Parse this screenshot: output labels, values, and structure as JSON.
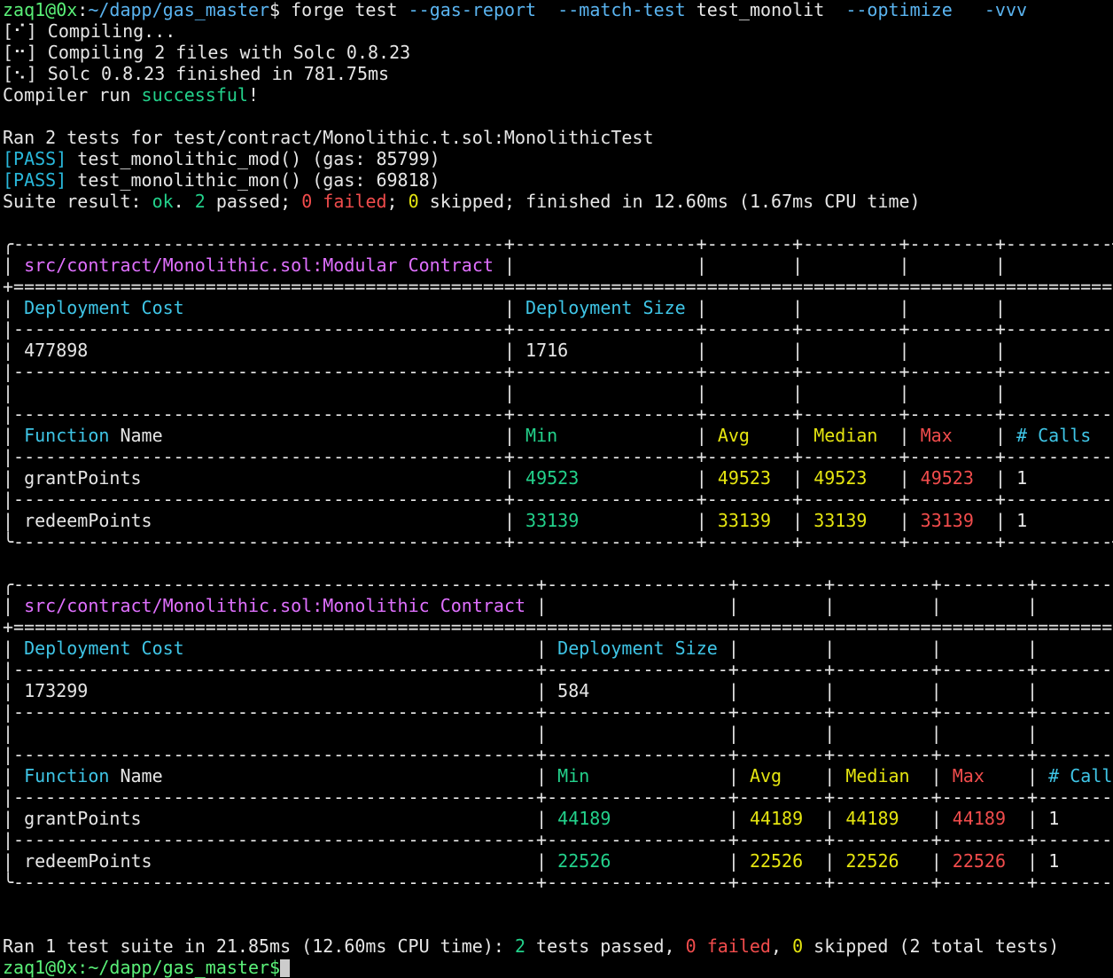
{
  "prompt": {
    "user_host": "zaq1@0x",
    "separator": ":",
    "path": "~/dapp/gas_master",
    "symbol": "$",
    "command": "forge test",
    "args": [
      {
        "text": "--gas-report",
        "kind": "flag"
      },
      {
        "text": "--match-test",
        "kind": "flag"
      },
      {
        "text": "test_monolit",
        "kind": "value"
      },
      {
        "text": "--optimize",
        "kind": "flag"
      },
      {
        "text": "-vvv",
        "kind": "flag"
      }
    ]
  },
  "compile": {
    "lines": [
      {
        "spinner": "[⠊]",
        "text": "Compiling..."
      },
      {
        "spinner": "[⠒]",
        "text": "Compiling 2 files with Solc 0.8.23"
      },
      {
        "spinner": "[⠢]",
        "text": "Solc 0.8.23 finished in 781.75ms"
      }
    ],
    "result_prefix": "Compiler run ",
    "result_word": "successful",
    "result_suffix": "!"
  },
  "tests": {
    "ran_line": "Ran 2 tests for test/contract/Monolithic.t.sol:MonolithicTest",
    "results": [
      {
        "status": "[PASS]",
        "text": "test_monolithic_mod() (gas: 85799)"
      },
      {
        "status": "[PASS]",
        "text": "test_monolithic_mon() (gas: 69818)"
      }
    ],
    "suite": {
      "label": "Suite result: ",
      "ok": "ok",
      "dot": ". ",
      "passed_num": "2",
      "passed_text": " passed; ",
      "failed_num": "0",
      "failed_word": " failed",
      "semi": "; ",
      "skipped_num": "0",
      "skipped_text": " skipped; finished in 12.60ms (1.67ms CPU time)"
    }
  },
  "reports": [
    {
      "title_path": "src/contract/Monolithic.sol:Modular",
      "title_word": "Contract",
      "deployment_header": [
        "Deployment Cost",
        "Deployment Size"
      ],
      "deployment_values": [
        "477898",
        "1716"
      ],
      "function_header": [
        "Function Name",
        "Min",
        "Avg",
        "Median",
        "Max",
        "# Calls"
      ],
      "rows": [
        [
          "grantPoints",
          "49523",
          "49523",
          "49523",
          "49523",
          "1"
        ],
        [
          "redeemPoints",
          "33139",
          "33139",
          "33139",
          "33139",
          "1"
        ]
      ]
    },
    {
      "title_path": "src/contract/Monolithic.sol:Monolithic",
      "title_word": "Contract",
      "deployment_header": [
        "Deployment Cost",
        "Deployment Size"
      ],
      "deployment_values": [
        "173299",
        "584"
      ],
      "function_header": [
        "Function Name",
        "Min",
        "Avg",
        "Median",
        "Max",
        "# Calls"
      ],
      "rows": [
        [
          "grantPoints",
          "44189",
          "44189",
          "44189",
          "44189",
          "1"
        ],
        [
          "redeemPoints",
          "22526",
          "22526",
          "22526",
          "22526",
          "1"
        ]
      ]
    }
  ],
  "summary": {
    "prefix": "Ran 1 test suite in 21.85ms (12.60ms CPU time): ",
    "passed_num": "2",
    "passed_text": " tests passed, ",
    "failed_num": "0",
    "failed_word": " failed",
    "comma": ", ",
    "skipped_num": "0",
    "skipped_text": " skipped (2 total tests)"
  },
  "next_prompt_fragment": "zaq1@0x:~/dapp/gas_master$"
}
